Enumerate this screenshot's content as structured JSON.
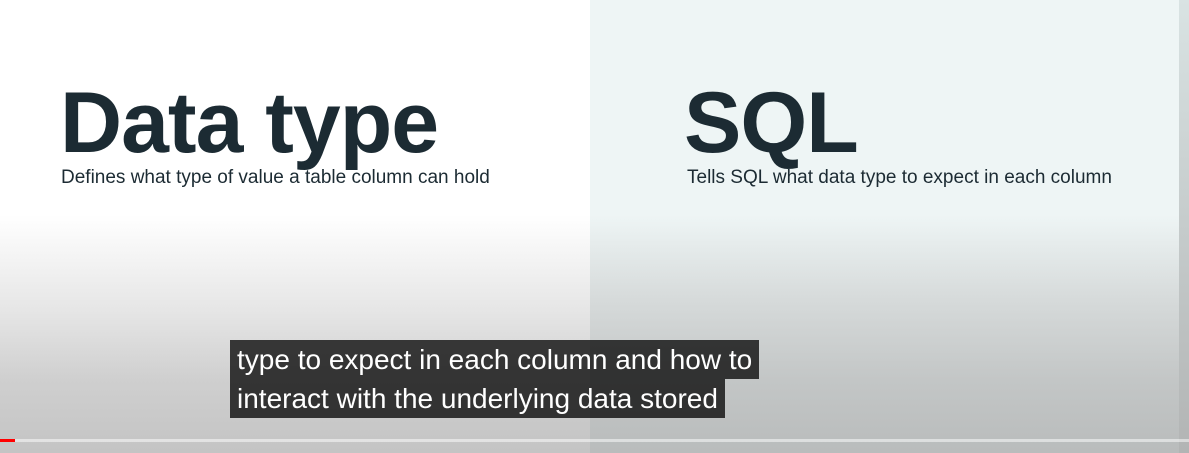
{
  "slide": {
    "left": {
      "heading": "Data type",
      "description": "Defines what type of value a table column can hold"
    },
    "right": {
      "heading": "SQL",
      "description": "Tells SQL what data type to expect in each column"
    }
  },
  "caption": {
    "line1": "type to expect in each column and how to",
    "line2": "interact with the underlying data stored"
  },
  "player": {
    "progress_fraction": 0.013,
    "progress_color": "#ff0000"
  },
  "colors": {
    "heading_text": "#1c2b33",
    "left_panel_bg": "#ffffff",
    "right_panel_bg": "#eef5f5"
  }
}
